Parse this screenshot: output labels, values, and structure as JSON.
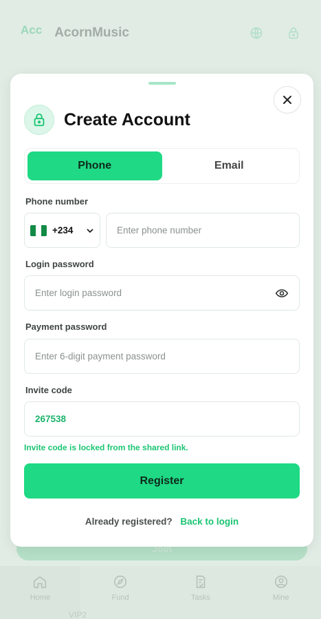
{
  "background": {
    "logo_text": "Acc",
    "brand": "AcornMusic",
    "join_label": "Join",
    "vip_label": "VIP2",
    "nav": [
      {
        "label": "Home",
        "icon": "home-icon"
      },
      {
        "label": "Fund",
        "icon": "compass-icon"
      },
      {
        "label": "Tasks",
        "icon": "tasks-icon"
      },
      {
        "label": "Mine",
        "icon": "user-icon"
      }
    ]
  },
  "modal": {
    "title": "Create Account",
    "tabs": [
      {
        "label": "Phone",
        "active": true
      },
      {
        "label": "Email",
        "active": false
      }
    ],
    "phone_label": "Phone number",
    "country_code": "+234",
    "phone_placeholder": "Enter phone number",
    "login_password_label": "Login password",
    "login_password_placeholder": "Enter login password",
    "payment_password_label": "Payment password",
    "payment_password_placeholder": "Enter 6-digit payment password",
    "invite_label": "Invite code",
    "invite_value": "267538",
    "invite_hint": "Invite code is locked from the shared link.",
    "register_label": "Register",
    "footer_question": "Already registered?",
    "footer_link": "Back to login"
  },
  "colors": {
    "accent": "#1fd984",
    "accent_text": "#19c472",
    "flag_green": "#118a45",
    "flag_white": "#ffffff"
  }
}
